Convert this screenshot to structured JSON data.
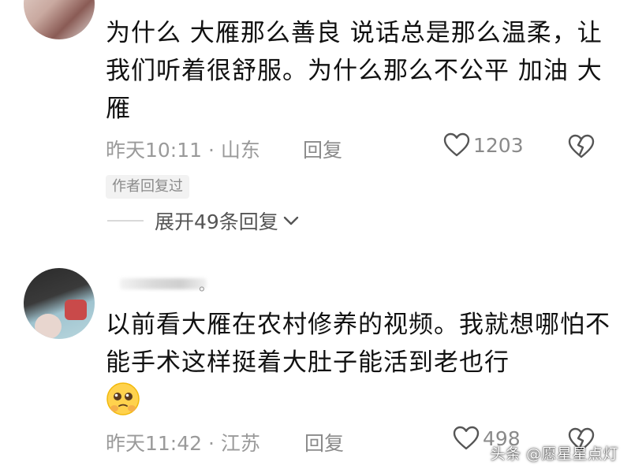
{
  "comment1": {
    "text": "为什么 大雁那么善良 说话总是那么温柔，让我们听着很舒服。为什么那么不公平  加油  大雁",
    "time_location": "昨天10:11 · 山东",
    "reply_label": "回复",
    "like_count": "1203",
    "author_badge": "作者回复过",
    "expand_label": "展开49条回复"
  },
  "comment2": {
    "name_suffix": "。",
    "text": "以前看大雁在农村修养的视频。我就想哪怕不能手术这样挺着大肚子能活到老也行",
    "emoji": "pleading-face",
    "time_location": "昨天11:42 · 江苏",
    "reply_label": "回复",
    "like_count": "498"
  },
  "watermark": "头条 @愿星星点灯",
  "colors": {
    "meta": "#9a9a9a",
    "text": "#111111",
    "badge_bg": "#f2f2f2"
  }
}
